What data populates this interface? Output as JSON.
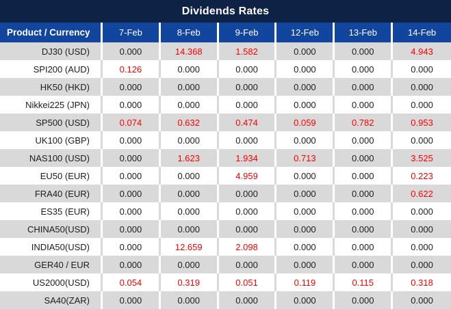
{
  "title": "Dividends Rates",
  "colors": {
    "banner_bg": "#0d2244",
    "header_bg": "#12459e",
    "header_text": "#ffffff",
    "row_alt_bg": "#d9d9d9",
    "row_bg": "#ffffff",
    "value_default": "#1c1c1c",
    "value_highlight": "#fe0000"
  },
  "chart_data": {
    "type": "table",
    "title": "Dividends Rates",
    "columns": [
      "Product / Currency",
      "7-Feb",
      "8-Feb",
      "9-Feb",
      "12-Feb",
      "13-Feb",
      "14-Feb"
    ],
    "rows": [
      {
        "product": "DJ30 (USD)",
        "values": [
          "0.000",
          "14.368",
          "1.582",
          "0.000",
          "0.000",
          "4.943"
        ],
        "highlight": [
          false,
          true,
          true,
          false,
          false,
          true
        ]
      },
      {
        "product": "SPI200 (AUD)",
        "values": [
          "0.126",
          "0.000",
          "0.000",
          "0.000",
          "0.000",
          "0.000"
        ],
        "highlight": [
          true,
          false,
          false,
          false,
          false,
          false
        ]
      },
      {
        "product": "HK50 (HKD)",
        "values": [
          "0.000",
          "0.000",
          "0.000",
          "0.000",
          "0.000",
          "0.000"
        ],
        "highlight": [
          false,
          false,
          false,
          false,
          false,
          false
        ]
      },
      {
        "product": "Nikkei225 (JPN)",
        "values": [
          "0.000",
          "0.000",
          "0.000",
          "0.000",
          "0.000",
          "0.000"
        ],
        "highlight": [
          false,
          false,
          false,
          false,
          false,
          false
        ]
      },
      {
        "product": "SP500 (USD)",
        "values": [
          "0.074",
          "0.632",
          "0.474",
          "0.059",
          "0.782",
          "0.953"
        ],
        "highlight": [
          true,
          true,
          true,
          true,
          true,
          true
        ]
      },
      {
        "product": "UK100 (GBP)",
        "values": [
          "0.000",
          "0.000",
          "0.000",
          "0.000",
          "0.000",
          "0.000"
        ],
        "highlight": [
          false,
          false,
          false,
          false,
          false,
          false
        ]
      },
      {
        "product": "NAS100 (USD)",
        "values": [
          "0.000",
          "1.623",
          "1.934",
          "0.713",
          "0.000",
          "3.525"
        ],
        "highlight": [
          false,
          true,
          true,
          true,
          false,
          true
        ]
      },
      {
        "product": "EU50 (EUR)",
        "values": [
          "0.000",
          "0.000",
          "4.959",
          "0.000",
          "0.000",
          "0.223"
        ],
        "highlight": [
          false,
          false,
          true,
          false,
          false,
          true
        ]
      },
      {
        "product": "FRA40 (EUR)",
        "values": [
          "0.000",
          "0.000",
          "0.000",
          "0.000",
          "0.000",
          "0.622"
        ],
        "highlight": [
          false,
          false,
          false,
          false,
          false,
          true
        ]
      },
      {
        "product": "ES35 (EUR)",
        "values": [
          "0.000",
          "0.000",
          "0.000",
          "0.000",
          "0.000",
          "0.000"
        ],
        "highlight": [
          false,
          false,
          false,
          false,
          false,
          false
        ]
      },
      {
        "product": "CHINA50(USD)",
        "values": [
          "0.000",
          "0.000",
          "0.000",
          "0.000",
          "0.000",
          "0.000"
        ],
        "highlight": [
          false,
          false,
          false,
          false,
          false,
          false
        ]
      },
      {
        "product": "INDIA50(USD)",
        "values": [
          "0.000",
          "12.659",
          "2.098",
          "0.000",
          "0.000",
          "0.000"
        ],
        "highlight": [
          false,
          true,
          true,
          false,
          false,
          false
        ]
      },
      {
        "product": "GER40 / EUR",
        "values": [
          "0.000",
          "0.000",
          "0.000",
          "0.000",
          "0.000",
          "0.000"
        ],
        "highlight": [
          false,
          false,
          false,
          false,
          false,
          false
        ]
      },
      {
        "product": "US2000(USD)",
        "values": [
          "0.054",
          "0.319",
          "0.051",
          "0.119",
          "0.115",
          "0.318"
        ],
        "highlight": [
          true,
          true,
          true,
          true,
          true,
          true
        ]
      },
      {
        "product": "SA40(ZAR)",
        "values": [
          "0.000",
          "0.000",
          "0.000",
          "0.000",
          "0.000",
          "0.000"
        ],
        "highlight": [
          false,
          false,
          false,
          false,
          false,
          false
        ]
      }
    ]
  }
}
